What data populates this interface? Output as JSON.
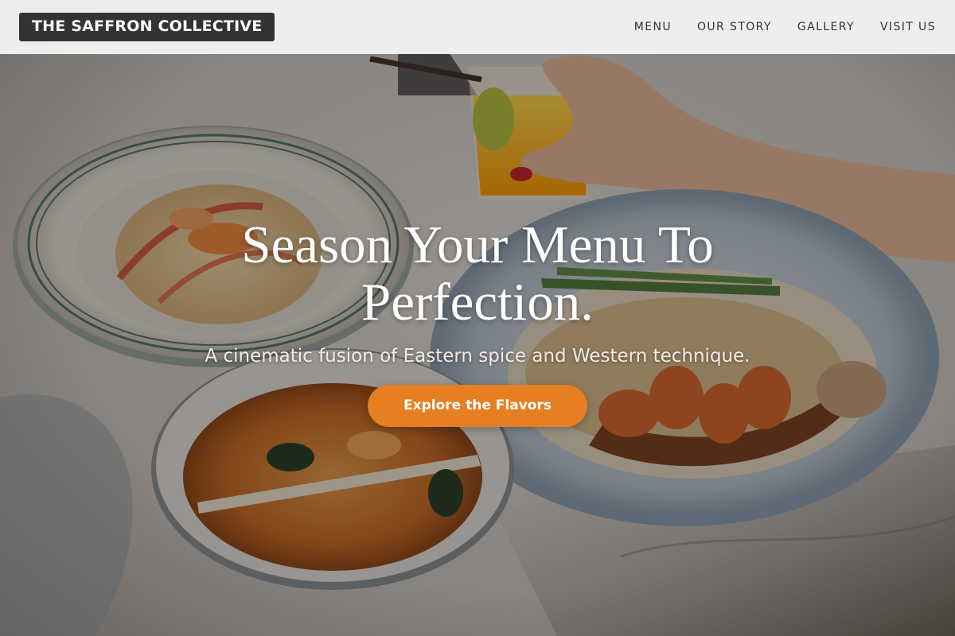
{
  "header": {
    "brand": "THE SAFFRON COLLECTIVE",
    "nav": [
      {
        "label": "MENU"
      },
      {
        "label": "OUR STORY"
      },
      {
        "label": "GALLERY"
      },
      {
        "label": "VISIT US"
      }
    ]
  },
  "hero": {
    "headline": "Season Your Menu To Perfection.",
    "tagline": "A cinematic fusion of Eastern spice and Western technique.",
    "cta_label": "Explore the Flavors"
  },
  "colors": {
    "accent": "#e67e22",
    "brand_bg": "#333333",
    "header_bg": "#f3f3f3",
    "text_light": "#ffffff"
  }
}
